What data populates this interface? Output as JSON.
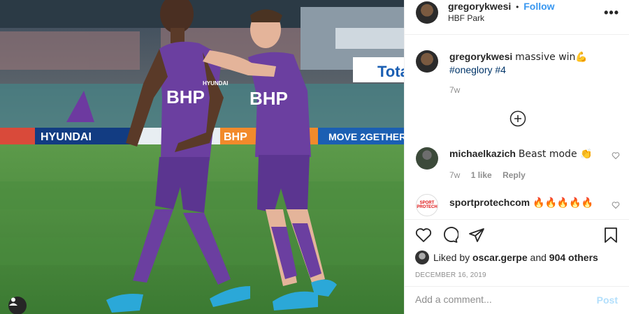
{
  "photo": {
    "board_1": "HYUNDAI",
    "board_2": "BHP",
    "board_3": "MOVE 2GETHER",
    "board_4": "Tota",
    "shirt_sponsor_1": "BHP",
    "shirt_sponsor_2": "BHP",
    "shirt_partner": "HYUNDAI"
  },
  "header": {
    "username": "gregorykwesi",
    "separator": "•",
    "follow_label": "Follow",
    "location": "HBF Park",
    "more_label": "•••"
  },
  "caption": {
    "username": "gregorykwesi",
    "text": "massive win💪",
    "hashtag_1": "#oneglory",
    "hashtag_2": "#4",
    "time": "7w"
  },
  "comments": [
    {
      "username": "michaelkazich",
      "text": "Beast mode 👏",
      "time": "7w",
      "likes": "1 like",
      "reply": "Reply"
    },
    {
      "username": "sportprotechcom",
      "text": "🔥🔥🔥🔥🔥",
      "avatar_text": "SPORT PROTECH"
    }
  ],
  "likes": {
    "prefix": "Liked by",
    "user": "oscar.gerpe",
    "joiner": "and",
    "others": "904 others"
  },
  "date": "DECEMBER 16, 2019",
  "comment_input": {
    "placeholder": "Add a comment..."
  },
  "post_label": "Post",
  "colors": {
    "link": "#3897f0",
    "kit_purple": "#6b3fa0",
    "pitch": "#3d7f35"
  },
  "icons": [
    "heart-icon",
    "comment-icon",
    "share-icon",
    "bookmark-icon",
    "plus-circle-icon",
    "user-tag-icon"
  ]
}
